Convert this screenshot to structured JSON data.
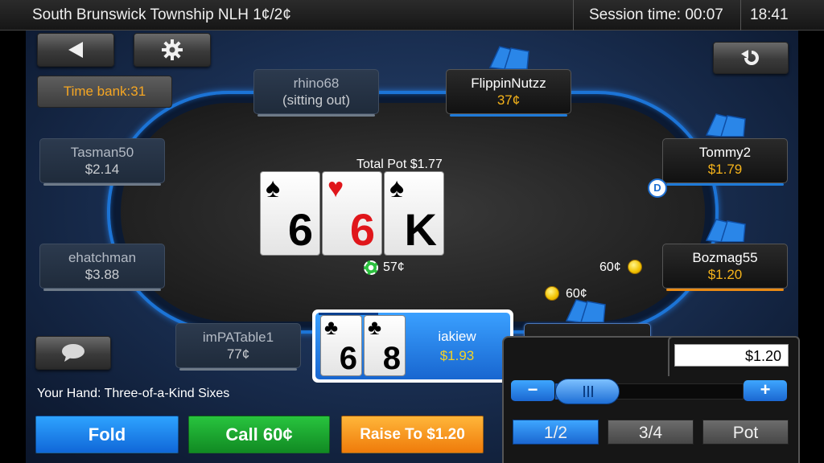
{
  "topbar": {
    "table_name": "South Brunswick Township NLH 1¢/2¢",
    "session_time": "Session time: 00:07",
    "clock": "18:41"
  },
  "controls": {
    "back_icon": "back-arrow-icon",
    "settings_icon": "gear-icon",
    "refresh_icon": "refresh-icon",
    "chat_icon": "chat-bubble-icon",
    "time_bank": "Time bank:31"
  },
  "seats": {
    "rhino68": {
      "name": "rhino68",
      "stack": "(sitting out)"
    },
    "flippin": {
      "name": "FlippinNutzz",
      "stack": "37¢"
    },
    "tommy2": {
      "name": "Tommy2",
      "stack": "$1.79"
    },
    "bozmag": {
      "name": "Bozmag55",
      "stack": "$1.20"
    },
    "tasman": {
      "name": "Tasman50",
      "stack": "$2.14"
    },
    "ehatch": {
      "name": "ehatchman",
      "stack": "$3.88"
    },
    "impa": {
      "name": "imPATable1",
      "stack": "77¢"
    }
  },
  "hero": {
    "name": "iakiew",
    "stack": "$1.93",
    "cards": [
      {
        "suit": "♣",
        "rank": "6"
      },
      {
        "suit": "♣",
        "rank": "8"
      }
    ]
  },
  "board": {
    "pot_label": "Total Pot $1.77",
    "cards": [
      {
        "suit": "♠",
        "rank": "6",
        "color": "#000000"
      },
      {
        "suit": "♥",
        "rank": "6",
        "color": "#e0161b"
      },
      {
        "suit": "♠",
        "rank": "K",
        "color": "#000000"
      }
    ],
    "pot_chips": "57¢"
  },
  "bets": {
    "bozmag": "60¢",
    "hero": "60¢"
  },
  "dealer_button": "D",
  "your_hand": "Your Hand: Three-of-a-Kind Sixes",
  "actions": {
    "fold": "Fold",
    "call": "Call 60¢",
    "raise": "Raise To $1.20",
    "call_small": "Call"
  },
  "raise_panel": {
    "amount": "$1.20",
    "minus": "−",
    "plus": "+",
    "presets": [
      "1/2",
      "3/4",
      "Pot"
    ],
    "selected_preset": "1/2"
  },
  "colors": {
    "accent_blue": "#1e7ad8",
    "fold": "#1067d8",
    "call": "#118a23",
    "raise": "#ef7b0a",
    "stack_gold": "#f5b31a"
  }
}
